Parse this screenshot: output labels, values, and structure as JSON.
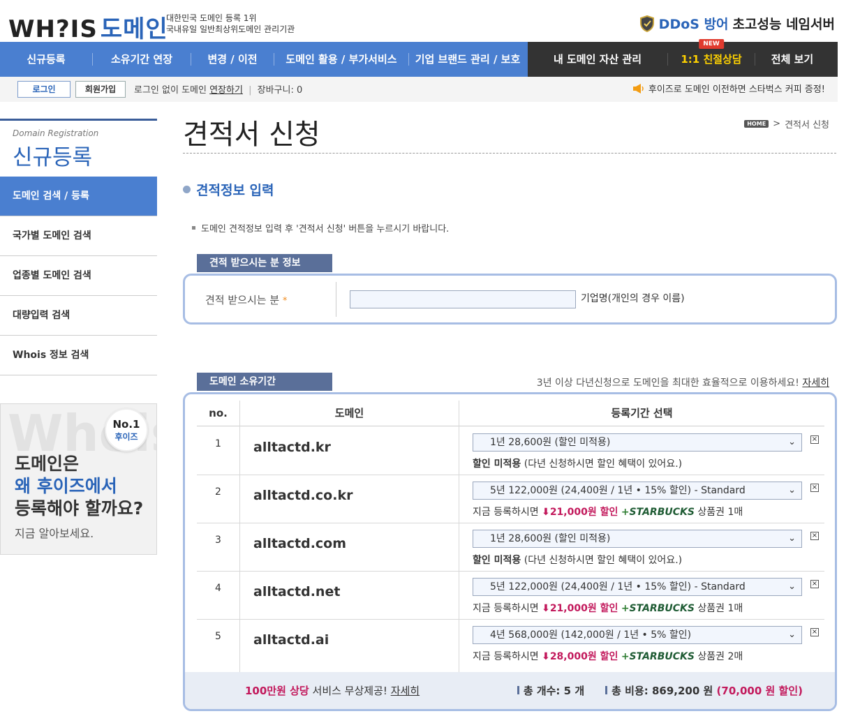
{
  "header": {
    "logo_en": "WH?IS",
    "logo_ko": "도메인",
    "tagline_1": "대한민국 도메인 등록 1위",
    "tagline_2": "국내유일 일반최상위도메인 관리기관",
    "ddos_blue": "DDoS 방어",
    "ddos_rest": "초고성능 네임서버"
  },
  "nav": {
    "items": [
      "신규등록",
      "소유기간 연장",
      "변경 / 이전",
      "도메인 활용 / 부가서비스",
      "기업 브랜드 관리 / 보호"
    ],
    "dark_items": [
      "내 도메인 자산 관리",
      "1:1 친절상담",
      "전체 보기"
    ],
    "new_badge": "NEW"
  },
  "util": {
    "login": "로그인",
    "join": "회원가입",
    "text_prefix": "로그인 없이 도메인",
    "extend_link": "연장하기",
    "cart": "장바구니: 0",
    "promo": "후이즈로 도메인 이전하면 스타벅스 커피 증정!"
  },
  "sidebar": {
    "en": "Domain Registration",
    "ko": "신규등록",
    "items": [
      "도메인 검색 / 등록",
      "국가별 도메인 검색",
      "업종별 도메인 검색",
      "대량입력 검색",
      "Whois 정보 검색"
    ]
  },
  "banner": {
    "badge_no": "No.1",
    "badge_sub": "후이즈",
    "line1": "도메인은",
    "line2": "왜 후이즈에서",
    "line3": "등록해야 할까요?",
    "line4": "지금 알아보세요."
  },
  "main": {
    "title": "견적서 신청",
    "breadcrumb_home": "HOME",
    "breadcrumb_current": "견적서 신청",
    "section_title": "견적정보 입력",
    "instruction": "도메인 견적정보 입력 후 '견적서 신청' 버튼을 누르시기 바랍니다.",
    "tab1": "견적 받으시는 분 정보",
    "recipient_label": "견적 받으시는 분",
    "recipient_star": "*",
    "recipient_value": "",
    "recipient_hint": "기업명(개인의 경우 이름)",
    "tab2": "도메인 소유기간",
    "multi_year_promo": "3년 이상 다년신청으로 도메인을 최대한 효율적으로 이용하세요!",
    "multi_year_link": "자세히"
  },
  "table": {
    "headers": [
      "no.",
      "도메인",
      "등록기간 선택"
    ],
    "rows": [
      {
        "no": "1",
        "domain": "alltactd.kr",
        "select": "1년 28,600원 (할인 미적용)",
        "note_bold": "할인 미적용",
        "note_rest": "(다년 신청하시면 할인 혜택이 있어요.)"
      },
      {
        "no": "2",
        "domain": "alltactd.co.kr",
        "select": "5년 122,000원 (24,400원 / 1년 • 15% 할인) - Standard",
        "note_prefix": "지금 등록하시면",
        "discount": "21,000원 할인",
        "starbucks": "STARBUCKS",
        "voucher": "상품권 1매"
      },
      {
        "no": "3",
        "domain": "alltactd.com",
        "select": "1년 28,600원 (할인 미적용)",
        "note_bold": "할인 미적용",
        "note_rest": "(다년 신청하시면 할인 혜택이 있어요.)"
      },
      {
        "no": "4",
        "domain": "alltactd.net",
        "select": "5년 122,000원 (24,400원 / 1년 • 15% 할인) - Standard",
        "note_prefix": "지금 등록하시면",
        "discount": "21,000원 할인",
        "starbucks": "STARBUCKS",
        "voucher": "상품권 1매"
      },
      {
        "no": "5",
        "domain": "alltactd.ai",
        "select": "4년 568,000원 (142,000원 / 1년 • 5% 할인)",
        "note_prefix": "지금 등록하시면",
        "discount": "28,000원 할인",
        "starbucks": "STARBUCKS",
        "voucher": "상품권 2매"
      }
    ]
  },
  "footer": {
    "free_red": "100만원 상당",
    "free_rest": "서비스 무상제공!",
    "free_link": "자세히",
    "count": "총 개수: 5 개",
    "cost": "총 비용: 869,200 원",
    "cost_discount": "(70,000 원 할인)"
  },
  "colors": {
    "brand_blue": "#4a7fd0",
    "dark_nav": "#333333",
    "accent_red": "#c2185b",
    "starbucks_green": "#1e5b33"
  }
}
